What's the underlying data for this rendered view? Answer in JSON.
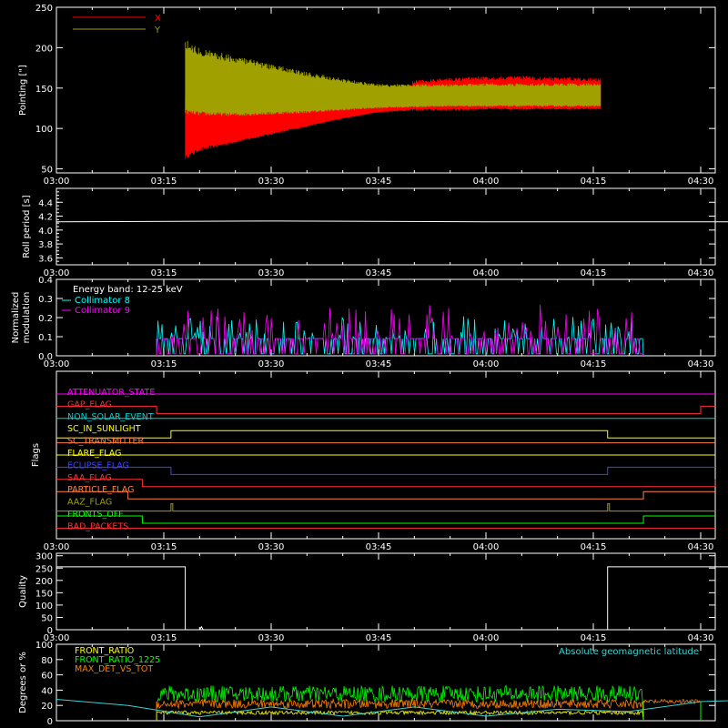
{
  "chart_data": [
    {
      "type": "line",
      "panel": "pointing",
      "ylabel": "Pointing [\"]",
      "ylim": [
        45,
        250
      ],
      "yticks": [
        50,
        100,
        150,
        200,
        250
      ],
      "xlim_minutes": [
        0,
        100
      ],
      "xticks": [
        "03:00",
        "03:15",
        "03:30",
        "03:45",
        "04:00",
        "04:15",
        "04:30"
      ],
      "legend_position": "top-left",
      "series": [
        {
          "name": "X",
          "color": "#ff0000",
          "x": [
            "03:00",
            "03:18",
            "03:18",
            "03:20",
            "03:25",
            "03:30",
            "03:35",
            "03:40",
            "03:45",
            "03:50",
            "03:55",
            "04:00",
            "04:05",
            "04:10",
            "04:16",
            "04:16",
            "04:40"
          ],
          "upper": [
            128,
            128,
            138,
            138,
            135,
            132,
            130,
            129,
            130,
            160,
            163,
            165,
            165,
            164,
            163,
            128,
            128
          ],
          "lower": [
            128,
            128,
            62,
            72,
            82,
            92,
            102,
            112,
            120,
            122,
            122,
            123,
            123,
            123,
            123,
            128,
            128
          ]
        },
        {
          "name": "Y",
          "color": "#a0a000",
          "x": [
            "03:00",
            "03:18",
            "03:18",
            "03:20",
            "03:25",
            "03:30",
            "03:35",
            "03:40",
            "03:45",
            "03:50",
            "03:55",
            "04:00",
            "04:05",
            "04:10",
            "04:16",
            "04:16",
            "04:40"
          ],
          "upper": [
            128,
            128,
            210,
            200,
            190,
            180,
            170,
            162,
            155,
            155,
            155,
            156,
            156,
            156,
            156,
            128,
            128
          ],
          "lower": [
            128,
            128,
            118,
            116,
            115,
            117,
            119,
            122,
            125,
            126,
            127,
            127,
            127,
            127,
            127,
            128,
            128
          ]
        }
      ]
    },
    {
      "type": "line",
      "panel": "roll",
      "ylabel": "Roll period [s]",
      "ylim": [
        3.5,
        4.6
      ],
      "yticks": [
        3.6,
        3.8,
        4.0,
        4.2,
        4.4
      ],
      "series": [
        {
          "name": "",
          "color": "#ffffff",
          "x": [
            "03:00",
            "03:30",
            "04:00",
            "04:15",
            "04:40"
          ],
          "values": [
            4.12,
            4.13,
            4.12,
            4.12,
            4.12
          ]
        }
      ]
    },
    {
      "type": "line",
      "panel": "modulation",
      "ylabel_lines": [
        "Normalized",
        "modulation"
      ],
      "ylim": [
        0,
        0.4
      ],
      "yticks": [
        0.0,
        0.1,
        0.2,
        0.3,
        0.4
      ],
      "annotation": "Energy band: 12-25 keV",
      "series": [
        {
          "name": "Collimator 8",
          "color": "#00ffff",
          "baseline": 0.09,
          "x_range": [
            "03:14",
            "04:22"
          ]
        },
        {
          "name": "Collimator 9",
          "color": "#ff00ff",
          "baseline": 0.09,
          "x_range": [
            "03:14",
            "04:22"
          ]
        }
      ]
    },
    {
      "type": "line",
      "panel": "flags",
      "ylabel": "Flags",
      "flags": [
        {
          "name": "ATTENUATOR_STATE",
          "color": "#ff00ff",
          "transitions": []
        },
        {
          "name": "GAP_FLAG",
          "color": "#ff3030",
          "transitions": [
            [
              "03:14",
              "down"
            ],
            [
              "04:30",
              "up"
            ]
          ]
        },
        {
          "name": "NON_SOLAR_EVENT",
          "color": "#00d0d0",
          "transitions": []
        },
        {
          "name": "SC_IN_SUNLIGHT",
          "color": "#ffff00",
          "transitions": [
            [
              "03:16",
              "up"
            ],
            [
              "04:17",
              "down"
            ]
          ]
        },
        {
          "name": "SC_TRANSMITTER",
          "color": "#ff8040",
          "transitions": []
        },
        {
          "name": "FLARE_FLAG",
          "color": "#ffff00",
          "transitions": []
        },
        {
          "name": "ECLIPSE_FLAG",
          "color": "#4040ff",
          "transitions": [
            [
              "03:16",
              "down"
            ],
            [
              "04:17",
              "up"
            ]
          ]
        },
        {
          "name": "SAA_FLAG",
          "color": "#ff3030",
          "transitions": [
            [
              "03:12",
              "down"
            ],
            [
              "04:32",
              "up"
            ]
          ]
        },
        {
          "name": "PARTICLE_FLAG",
          "color": "#ff8040",
          "transitions": [
            [
              "03:10",
              "down"
            ],
            [
              "04:22",
              "up"
            ]
          ]
        },
        {
          "name": "AAZ_FLAG",
          "color": "#a0a000",
          "transitions": [
            [
              "03:16",
              "spike"
            ],
            [
              "04:17",
              "spike"
            ]
          ]
        },
        {
          "name": "FRONTS_OFF",
          "color": "#00ff00",
          "transitions": [
            [
              "03:12",
              "down"
            ],
            [
              "04:22",
              "up"
            ]
          ]
        },
        {
          "name": "BAD_PACKETS",
          "color": "#ff3030",
          "transitions": []
        }
      ]
    },
    {
      "type": "line",
      "panel": "quality",
      "ylabel": "Quality",
      "ylim": [
        0,
        310
      ],
      "yticks": [
        0,
        50,
        100,
        150,
        200,
        250,
        300
      ],
      "series": [
        {
          "name": "",
          "color": "#ffffff",
          "x": [
            "03:00",
            "03:18",
            "03:18",
            "04:17",
            "04:17",
            "04:40"
          ],
          "values": [
            255,
            255,
            0,
            0,
            255,
            255
          ]
        }
      ]
    },
    {
      "type": "line",
      "panel": "geomagnetic",
      "ylabel": "Degrees or %",
      "ylim": [
        0,
        100
      ],
      "yticks": [
        0,
        20,
        40,
        60,
        80,
        100
      ],
      "annotation": "Absolute geomagnetic latitude",
      "series": [
        {
          "name": "FRONT_RATIO",
          "color": "#ffff00"
        },
        {
          "name": "FRONT_RATIO_1225",
          "color": "#00ff00"
        },
        {
          "name": "MAX_DET_VS_TOT",
          "color": "#ff8000"
        },
        {
          "name": "Absolute geomagnetic latitude",
          "color": "#40d0d0",
          "x": [
            "03:00",
            "03:10",
            "03:20",
            "03:30",
            "03:40",
            "03:50",
            "04:00",
            "04:10",
            "04:20",
            "04:30",
            "04:40"
          ],
          "values": [
            28,
            20,
            5,
            18,
            6,
            18,
            6,
            15,
            12,
            25,
            28
          ]
        }
      ]
    }
  ]
}
